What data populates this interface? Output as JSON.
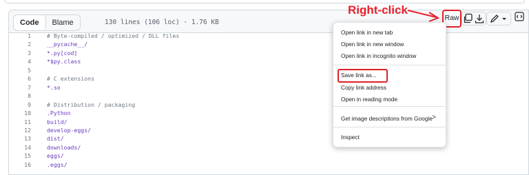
{
  "toolbar": {
    "code_tab": "Code",
    "blame_tab": "Blame",
    "meta": "130 lines (106 loc) · 1.76 KB",
    "raw_label": "Raw",
    "annotation": "Right-click"
  },
  "icons": {
    "copy": "copy-icon",
    "download": "download-icon",
    "edit": "pencil-icon",
    "dropdown": "chevron-down-icon",
    "symbols": "code-square-icon"
  },
  "code": {
    "lines": [
      {
        "n": "1",
        "text": "# Byte-compiled / optimized / DLL files",
        "kind": "comment"
      },
      {
        "n": "2",
        "text": "__pycache__/",
        "kind": "keyword"
      },
      {
        "n": "3",
        "text": "*.py[cod]",
        "kind": "keyword"
      },
      {
        "n": "4",
        "text": "*$py.class",
        "kind": "keyword"
      },
      {
        "n": "5",
        "text": "",
        "kind": "keyword"
      },
      {
        "n": "6",
        "text": "# C extensions",
        "kind": "comment"
      },
      {
        "n": "7",
        "text": "*.so",
        "kind": "keyword"
      },
      {
        "n": "8",
        "text": "",
        "kind": "keyword"
      },
      {
        "n": "9",
        "text": "# Distribution / packaging",
        "kind": "comment"
      },
      {
        "n": "10",
        "text": ".Python",
        "kind": "keyword"
      },
      {
        "n": "11",
        "text": "build/",
        "kind": "keyword"
      },
      {
        "n": "12",
        "text": "develop-eggs/",
        "kind": "keyword"
      },
      {
        "n": "13",
        "text": "dist/",
        "kind": "keyword"
      },
      {
        "n": "14",
        "text": "downloads/",
        "kind": "keyword"
      },
      {
        "n": "15",
        "text": "eggs/",
        "kind": "keyword"
      },
      {
        "n": "16",
        "text": ".eggs/",
        "kind": "keyword"
      }
    ]
  },
  "context_menu": {
    "items": [
      "Open link in new tab",
      "Open link in new window",
      "Open link in incognito window",
      "Save link as...",
      "Copy link address",
      "Open in reading mode",
      "Get image descriptions from Google",
      "Inspect"
    ],
    "submenu_arrow": ">"
  },
  "colors": {
    "annotation_red": "#e8202b",
    "comment": "#6e7781",
    "keyword": "#6639ba"
  }
}
